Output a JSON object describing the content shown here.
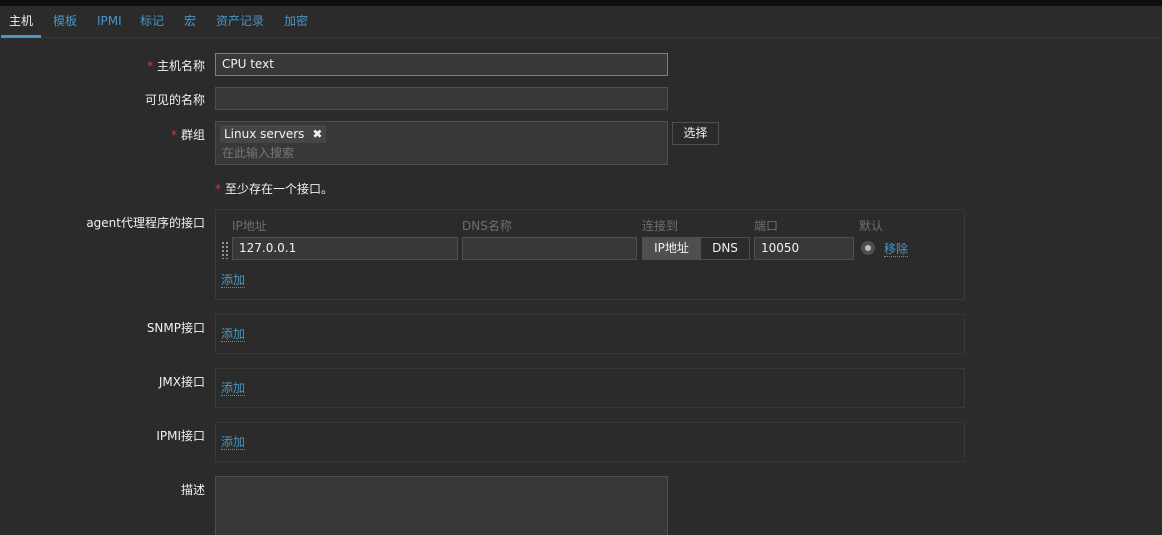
{
  "tabs": [
    {
      "label": "主机",
      "active": true
    },
    {
      "label": "模板",
      "active": false
    },
    {
      "label": "IPMI",
      "active": false
    },
    {
      "label": "标记",
      "active": false
    },
    {
      "label": "宏",
      "active": false
    },
    {
      "label": "资产记录",
      "active": false
    },
    {
      "label": "加密",
      "active": false
    }
  ],
  "form": {
    "required_mark": "*",
    "host_name": {
      "label": "主机名称",
      "value": "CPU text"
    },
    "visible_name": {
      "label": "可见的名称",
      "value": ""
    },
    "groups": {
      "label": "群组",
      "tag": "Linux servers",
      "tag_remove": "✖",
      "placeholder": "在此输入搜索",
      "select_button": "选择"
    },
    "interface_note": "至少存在一个接口。",
    "agent_interfaces": {
      "label": "agent代理程序的接口",
      "headers": {
        "ip": "IP地址",
        "dns": "DNS名称",
        "connect": "连接到",
        "port": "端口",
        "default": "默认"
      },
      "row": {
        "ip": "127.0.0.1",
        "dns": "",
        "connect_ip": "IP地址",
        "connect_dns": "DNS",
        "connect_selected": "IP地址",
        "port": "10050",
        "remove": "移除"
      },
      "add": "添加"
    },
    "snmp": {
      "label": "SNMP接口",
      "add": "添加"
    },
    "jmx": {
      "label": "JMX接口",
      "add": "添加"
    },
    "ipmi": {
      "label": "IPMI接口",
      "add": "添加"
    },
    "description": {
      "label": "描述",
      "value": ""
    }
  },
  "colors": {
    "accent": "#4796c4",
    "required": "#e33734",
    "background": "#2b2b2b"
  }
}
